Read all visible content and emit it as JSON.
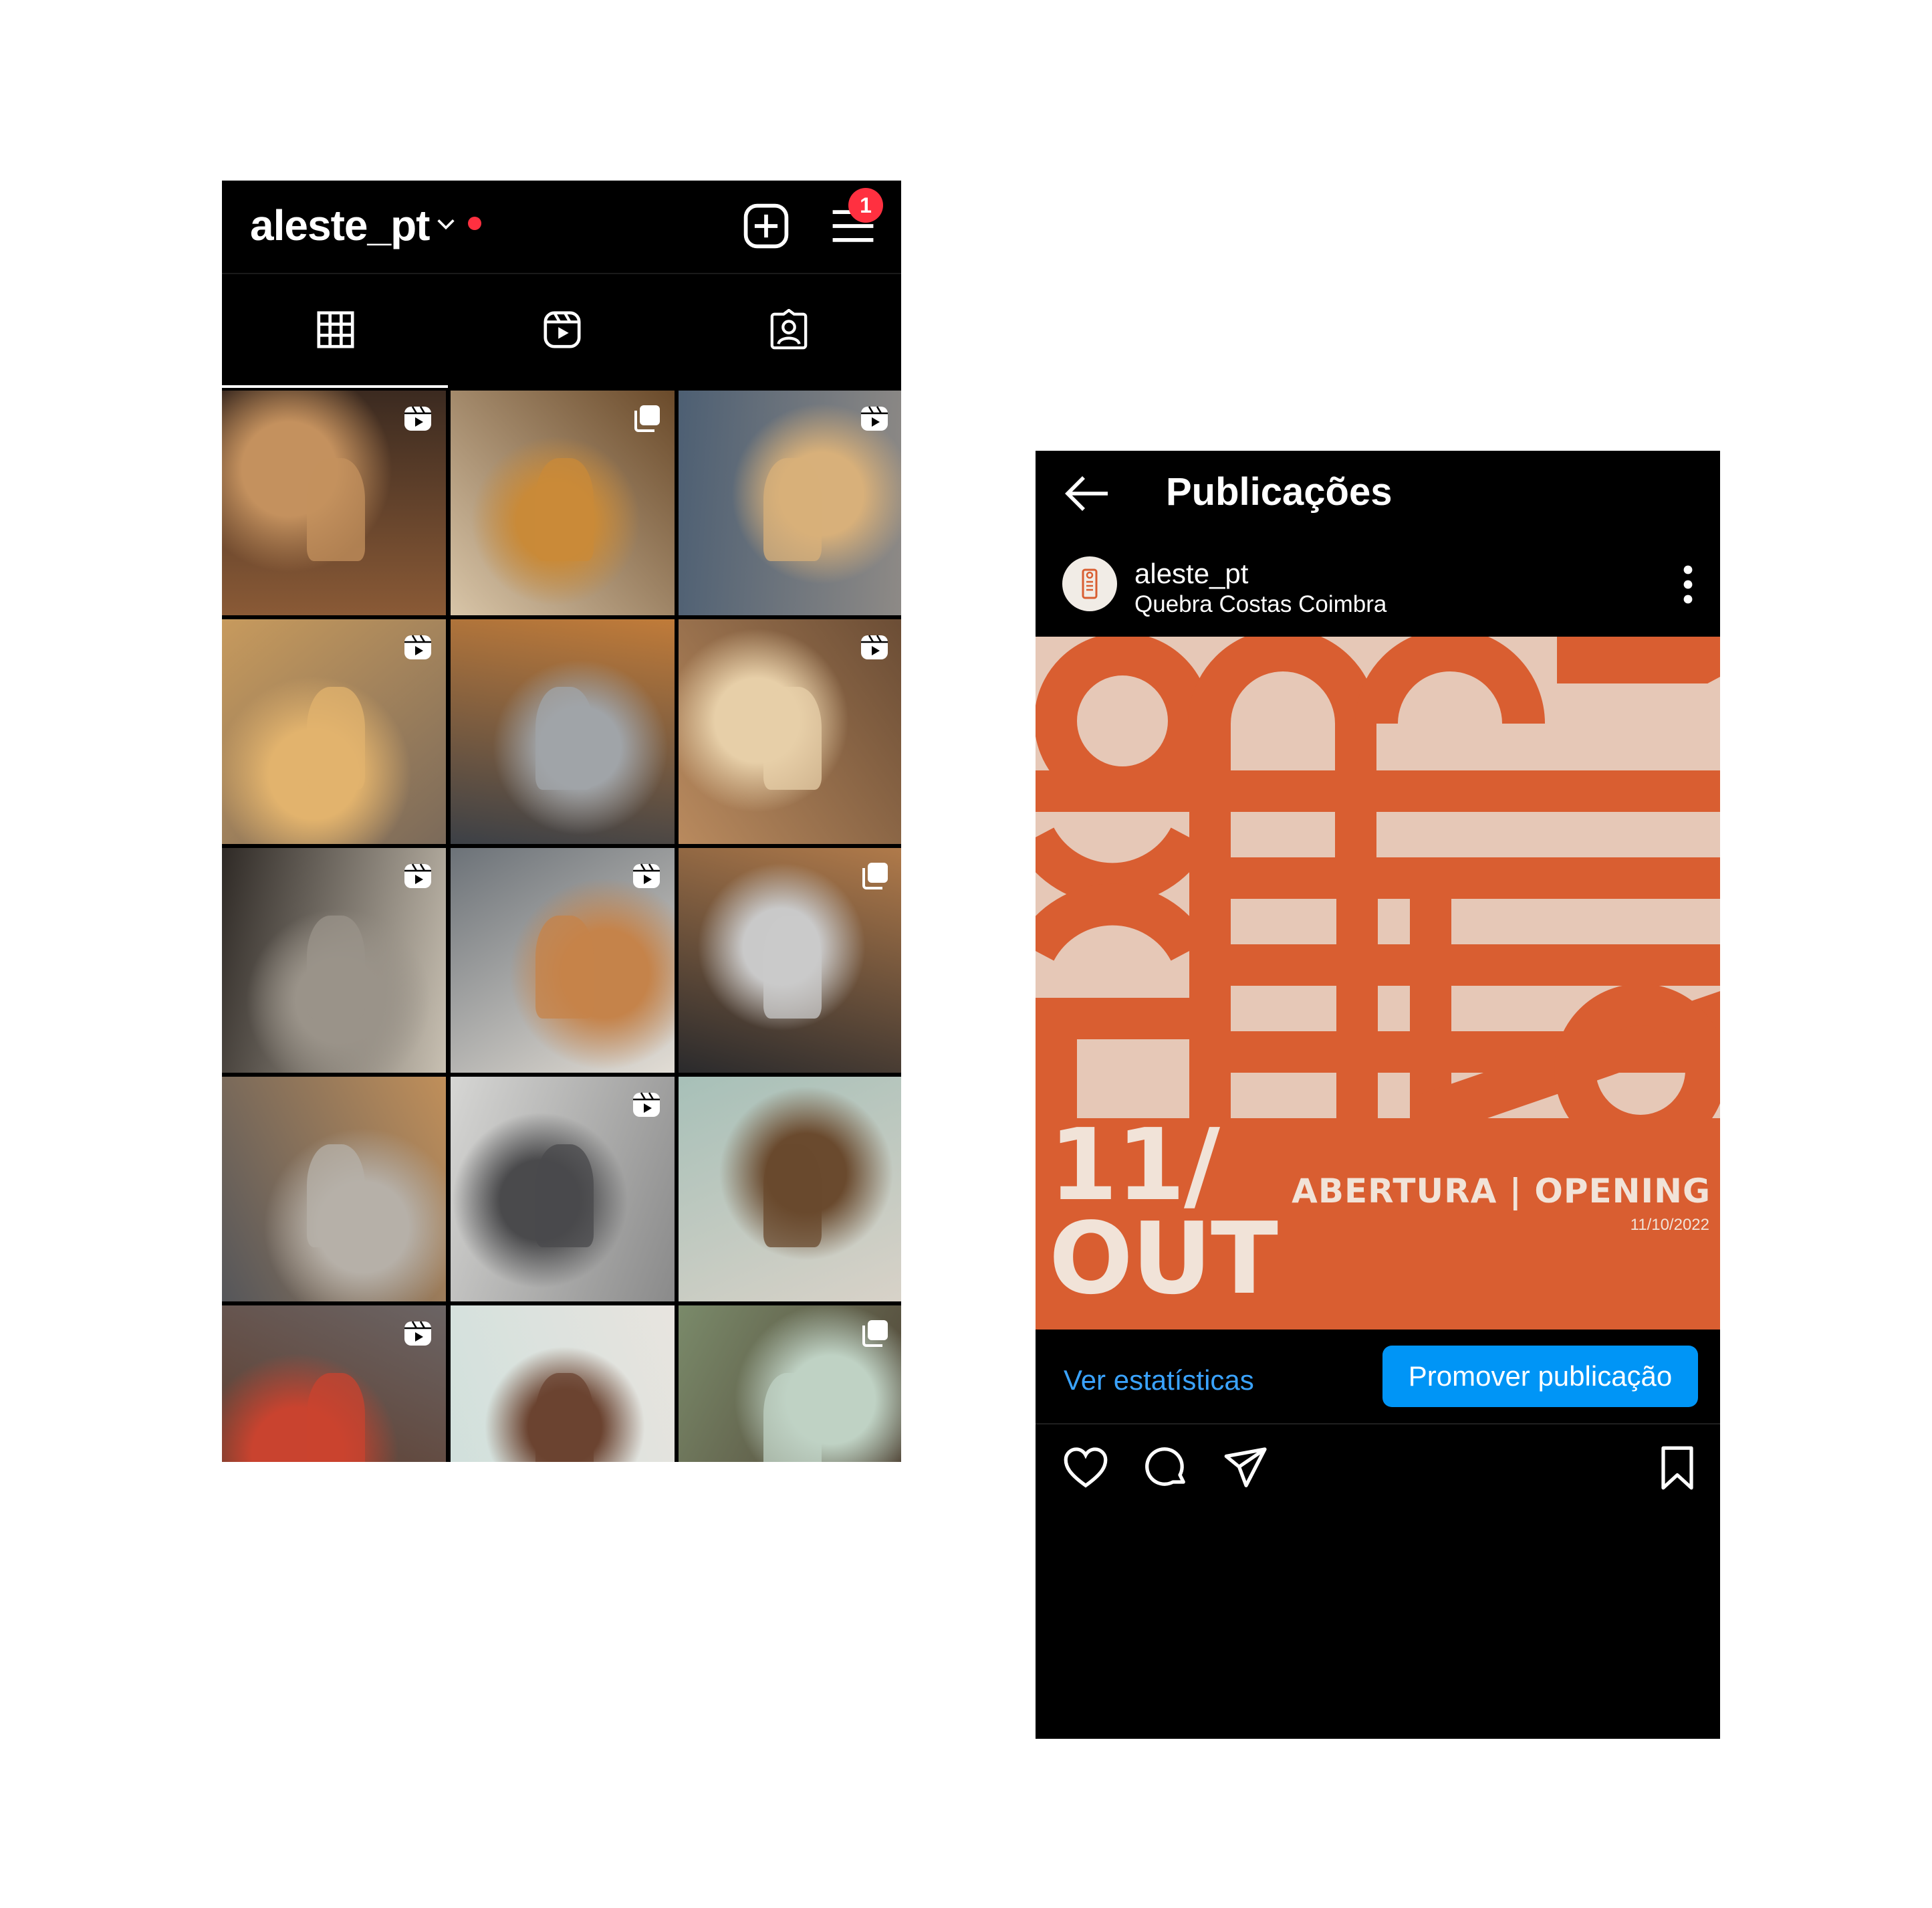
{
  "colors": {
    "background": "#000000",
    "accent_blue": "#0095f6",
    "notification_red": "#ff3040",
    "poster_orange": "#d95e31",
    "poster_beige": "#e6c8b7",
    "poster_text": "#f1e3d8"
  },
  "profile": {
    "username": "aleste_pt",
    "notification_count": "1",
    "icons": [
      "chevron-down-icon",
      "new-post-icon",
      "menu-icon"
    ],
    "tabs": [
      {
        "name": "posts-grid",
        "icon": "grid-icon",
        "active": true
      },
      {
        "name": "reels",
        "icon": "reels-icon",
        "active": false
      },
      {
        "name": "tagged",
        "icon": "tagged-user-icon",
        "active": false
      }
    ],
    "grid": [
      {
        "subject": "iced chocolate drink with chimney cakes",
        "overlay": "reels-icon"
      },
      {
        "subject": "chimney cake in cup with passion fruit",
        "overlay": "carousel-icon"
      },
      {
        "subject": "spreading cream into chimney cake",
        "overlay": "reels-icon"
      },
      {
        "subject": "hand holding chimney cake",
        "overlay": "reels-icon"
      },
      {
        "subject": "chimney cake on Coimbra stairs",
        "overlay": "none"
      },
      {
        "subject": "tray of chimney cakes",
        "overlay": "reels-icon"
      },
      {
        "subject": "Coimbra archway street",
        "overlay": "reels-icon"
      },
      {
        "subject": "chimney cake in cup held in street",
        "overlay": "reels-icon"
      },
      {
        "subject": "chimney cake over shop window",
        "overlay": "carousel-icon"
      },
      {
        "subject": "Coimbra street with chimney cake",
        "overlay": "none"
      },
      {
        "subject": "shop entrance with rain",
        "overlay": "reels-icon"
      },
      {
        "subject": "chocolate and nut ice cream cone",
        "overlay": "none"
      },
      {
        "subject": "strawberries in chocolate cone",
        "overlay": "reels-icon"
      },
      {
        "subject": "ice cream with wafer",
        "overlay": "none"
      },
      {
        "subject": "shop interior with paper birds",
        "overlay": "carousel-icon"
      }
    ]
  },
  "post": {
    "title": "Publicações",
    "author": "aleste_pt",
    "location": "Quebra Costas Coimbra",
    "poster": {
      "date_day": "11/",
      "date_month": "OUT",
      "tagline": "ABERTURA | OPENING",
      "date_full": "11/10/2022"
    },
    "stats_link": "Ver estatísticas",
    "promote_label": "Promover publicação",
    "action_icons": [
      "heart-icon",
      "comment-icon",
      "share-icon",
      "bookmark-icon"
    ]
  }
}
